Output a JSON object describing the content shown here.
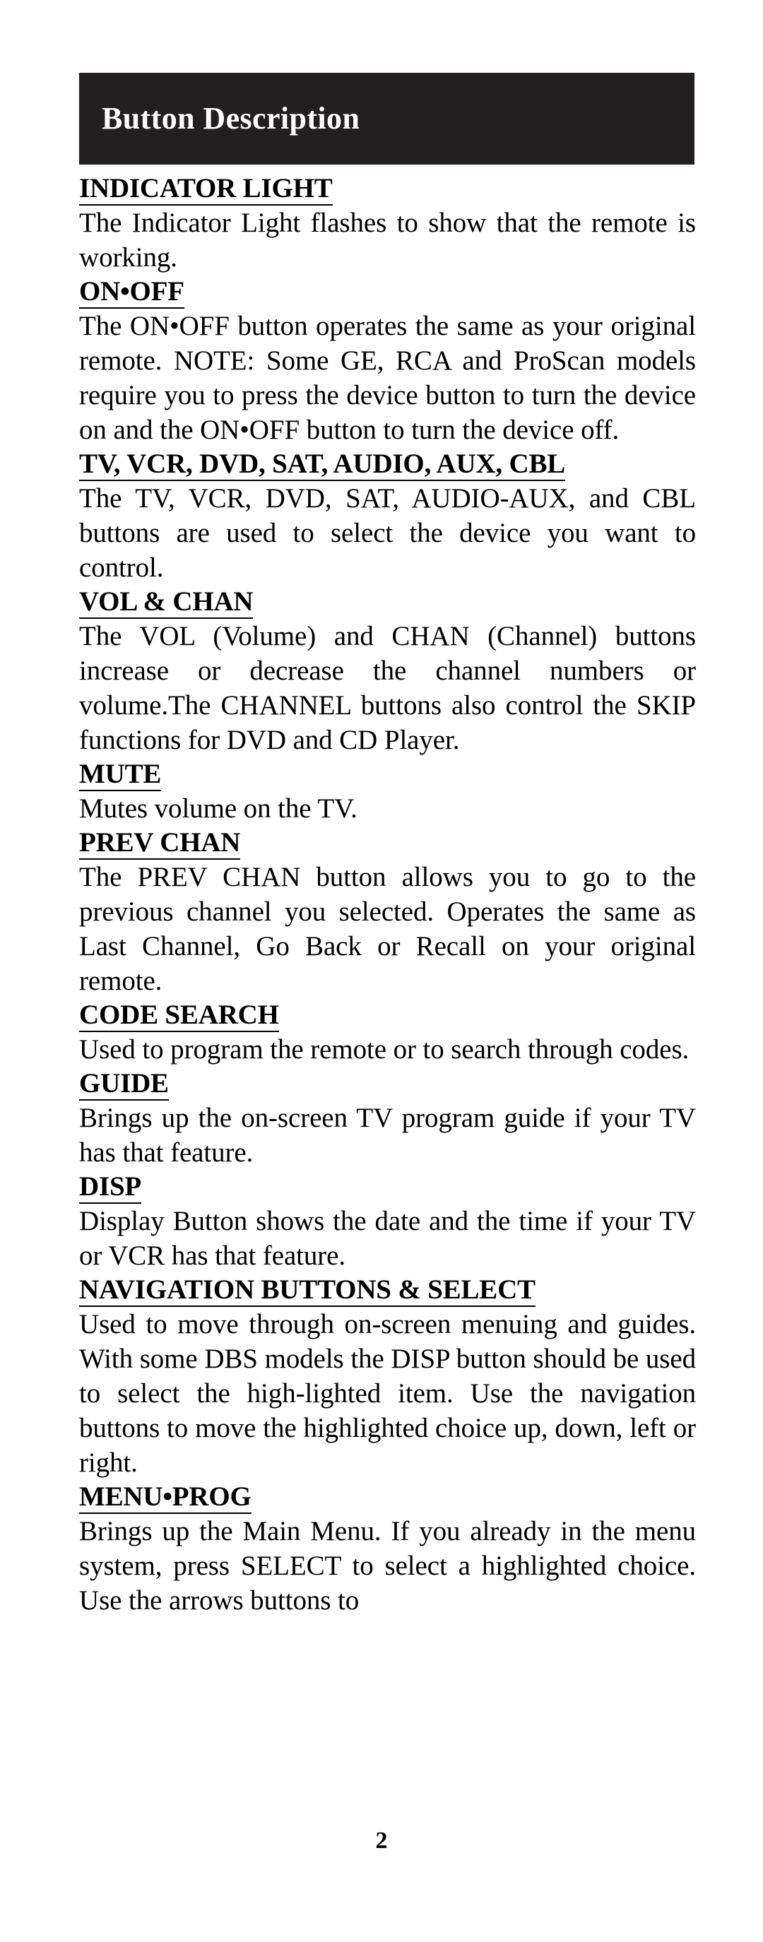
{
  "page": {
    "number": "2",
    "background_color": "#ffffff",
    "text_color": "#000000"
  },
  "header": {
    "title": "Button Description",
    "background_color": "#231f20",
    "text_color": "#ffffff"
  },
  "sections": [
    {
      "heading": "INDICATOR LIGHT",
      "body": "The Indicator Light flashes to show that the remote is working."
    },
    {
      "heading": "ON•OFF",
      "body": "The ON•OFF button operates the same as your original remote. NOTE: Some GE, RCA and ProScan models require you to press the device button to turn the device on and the ON•OFF button to turn the device off."
    },
    {
      "heading": "TV, VCR, DVD, SAT, AUDIO, AUX, CBL",
      "body": "The TV, VCR, DVD, SAT, AUDIO-AUX, and CBL buttons are used to select the device you want to control."
    },
    {
      "heading": "VOL & CHAN",
      "body": "The VOL (Volume) and CHAN (Channel) buttons increase or decrease the channel numbers or volume.The CHANNEL buttons also control the SKIP functions for DVD and CD Player."
    },
    {
      "heading": "MUTE",
      "body": "Mutes volume on the TV."
    },
    {
      "heading": "PREV CHAN",
      "body": "The PREV CHAN button allows you to go to the previous channel you selected. Operates the same as Last Channel, Go Back or Recall on your original remote."
    },
    {
      "heading": "CODE SEARCH",
      "body": "Used to program the remote or to search through codes."
    },
    {
      "heading": "GUIDE",
      "body": "Brings up the on-screen TV program guide if your TV has that feature."
    },
    {
      "heading": "DISP",
      "body": "Display Button shows the date and the time if your TV or VCR has that feature."
    },
    {
      "heading": "NAVIGATION BUTTONS & SELECT",
      "body": "Used to move through on-screen menuing and guides. With some DBS models the DISP button should be used to select the high-lighted item. Use the navigation buttons to move the highlighted choice up, down, left or right."
    },
    {
      "heading": "MENU•PROG",
      "body": "Brings up the Main Menu. If you already in the menu system, press SELECT to select a highlighted choice. Use the arrows buttons to"
    }
  ]
}
